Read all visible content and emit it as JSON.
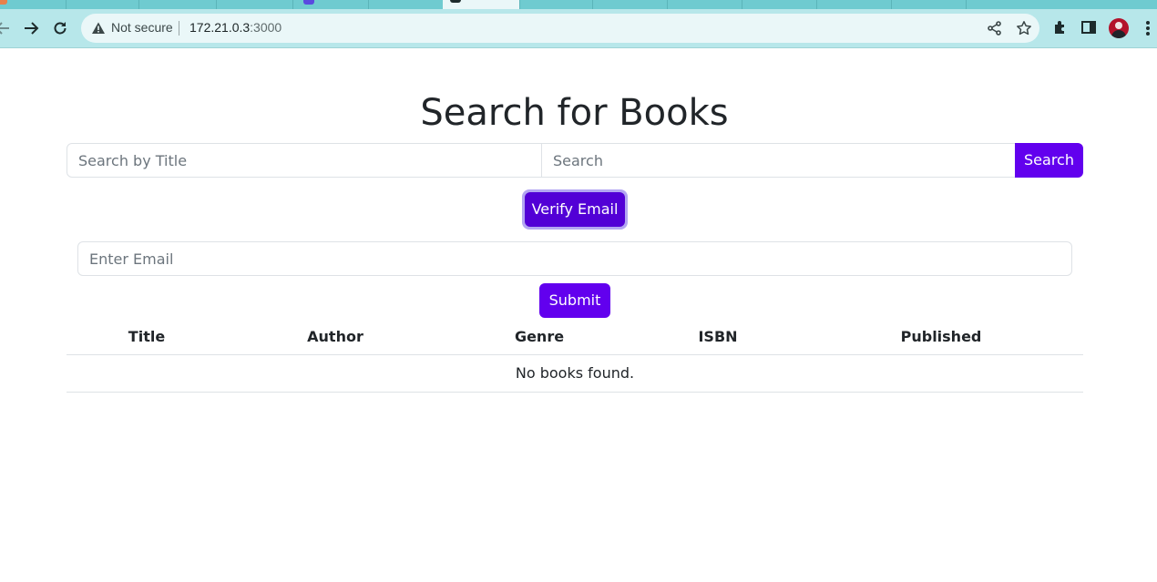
{
  "browser": {
    "security_status": "Not secure",
    "url_host": "172.21.0.3",
    "url_port": ":3000"
  },
  "page": {
    "title": "Search for Books",
    "search": {
      "title_placeholder": "Search by Title",
      "query_placeholder": "Search",
      "button_label": "Search"
    },
    "verify_button_label": "Verify Email",
    "email": {
      "placeholder": "Enter Email",
      "submit_label": "Submit"
    },
    "table": {
      "columns": [
        "Title",
        "Author",
        "Genre",
        "ISBN",
        "Published"
      ],
      "empty_message": "No books found."
    }
  },
  "colors": {
    "accent": "#6200ee",
    "accent_active": "#5200d6",
    "chrome_toolbar": "#b7e7ea",
    "chrome_tabstrip": "#6fcbd0"
  },
  "icons": [
    "back-icon",
    "forward-icon",
    "reload-icon",
    "warning-icon",
    "share-icon",
    "star-icon",
    "extensions-icon",
    "side-panel-icon",
    "avatar",
    "more-icon"
  ]
}
